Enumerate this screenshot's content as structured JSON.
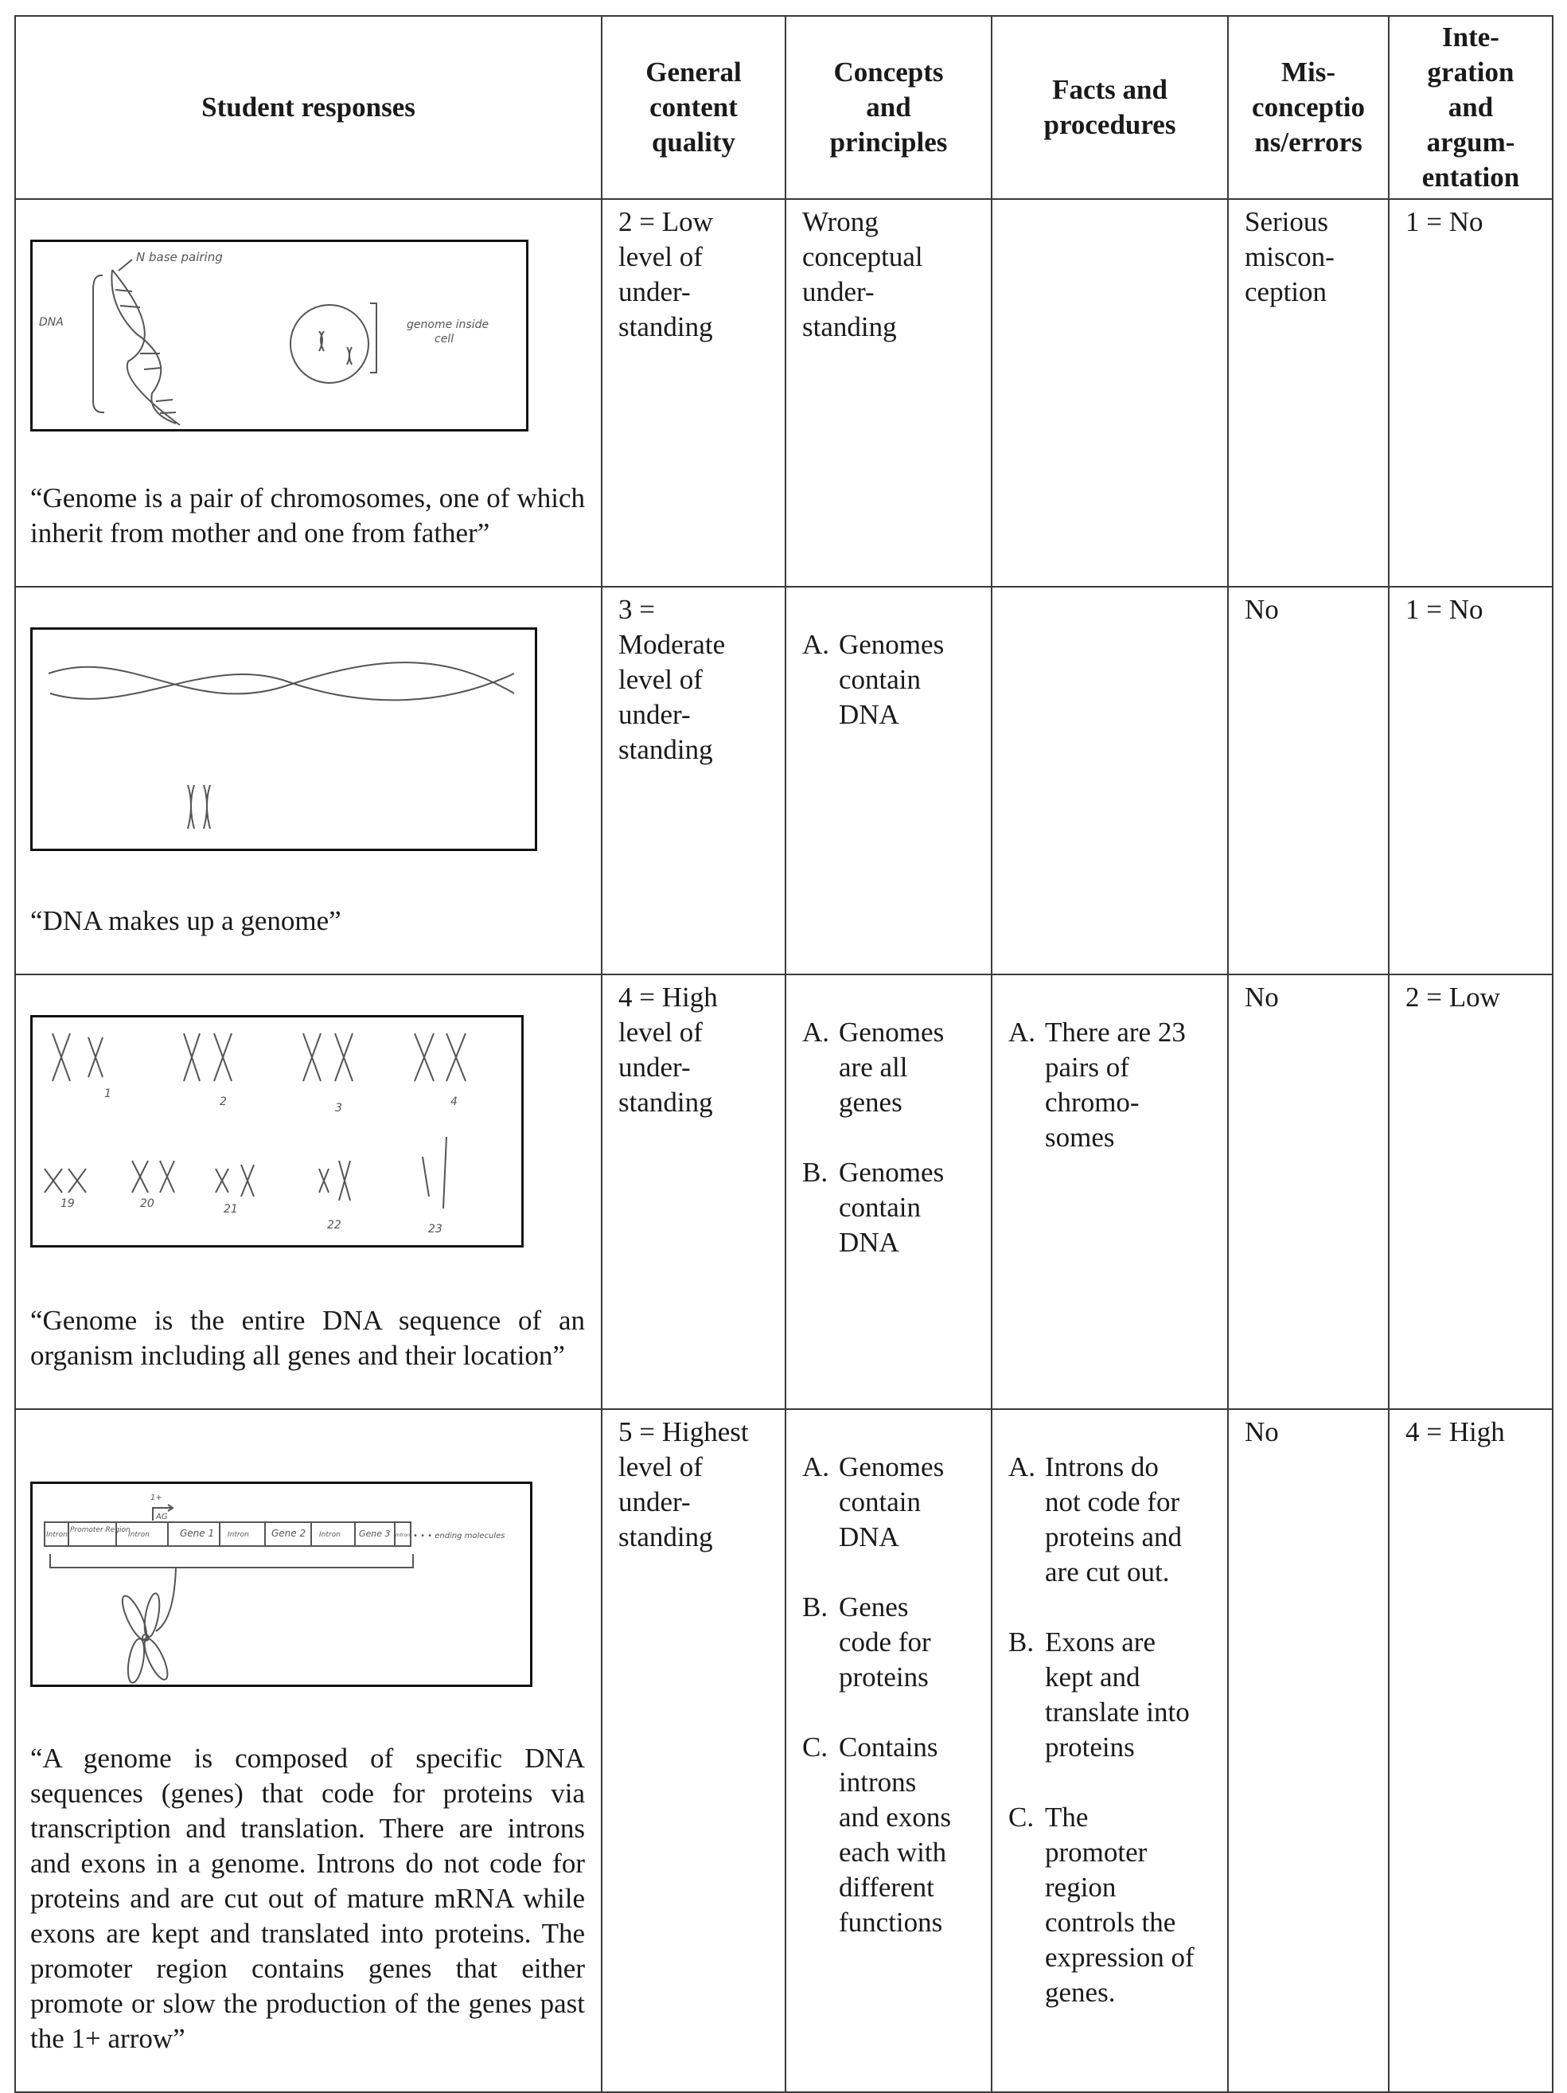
{
  "header": {
    "student_responses": "Student responses",
    "general_content_quality": "General\ncontent\nquality",
    "concepts_principles": "Concepts\nand\nprinciples",
    "facts_procedures": "Facts and\nprocedures",
    "misconceptions": "Mis-\nconceptio\nns/errors",
    "integration": "Inte-\ngration\nand\nargum-\nentation"
  },
  "rows": [
    {
      "sketch_labels": {
        "dna": "DNA",
        "base_pairing": "N base pairing",
        "genome_inside": "genome inside",
        "cell": "cell"
      },
      "quote": "“Genome is a pair of chromosomes, one of which inherit from mother and one from father”",
      "quality": "2 = Low\nlevel of\nunder-\nstanding",
      "concepts_text": "Wrong\nconceptual\nunder-\nstanding",
      "misconceptions": "Serious\nmiscon-\nception",
      "integration": "1 = No"
    },
    {
      "quote": "“DNA makes up a genome”",
      "quality": "3 =\nModerate\nlevel of\nunder-\nstanding",
      "concepts": [
        {
          "marker": "A.",
          "text": "Genomes\ncontain\nDNA"
        }
      ],
      "misconceptions": "No",
      "integration": "1 = No"
    },
    {
      "sketch_labels": [
        "1",
        "2",
        "3",
        "4",
        "19",
        "20",
        "21",
        "22",
        "23"
      ],
      "quote": "“Genome is the entire DNA sequence of an organism including all genes and their location”",
      "quality": "4 = High\nlevel of\nunder-\nstanding",
      "concepts": [
        {
          "marker": "A.",
          "text": "Genomes\nare all\ngenes"
        },
        {
          "marker": "B.",
          "text": "Genomes\ncontain\nDNA"
        }
      ],
      "facts": [
        {
          "marker": "A.",
          "text": "There are 23\npairs of\nchromo-\nsomes"
        }
      ],
      "misconceptions": "No",
      "integration": "2 = Low"
    },
    {
      "sketch_labels": {
        "segments": [
          "Intron",
          "Promoter Region",
          "Intron",
          "Gene 1",
          "Intron",
          "Gene 2",
          "Intron",
          "Gene 3",
          "Intron"
        ],
        "start": "1+",
        "codon": "AG",
        "ending": "• • • ending molecules"
      },
      "quote": "“A genome is composed of specific DNA sequences (genes) that code for proteins via transcription and translation. There are introns and exons in a genome. Introns do not code for proteins and are cut out of mature mRNA while exons are kept and translated into proteins. The promoter region contains genes that either promote or slow the production of the genes past the 1+ arrow”",
      "quality": "5 = Highest\nlevel of\nunder-\nstanding",
      "concepts": [
        {
          "marker": "A.",
          "text": "Genomes\ncontain\nDNA"
        },
        {
          "marker": "B.",
          "text": "Genes\ncode for\nproteins"
        },
        {
          "marker": "C.",
          "text": "Contains\nintrons\nand exons\neach with\ndifferent\nfunctions"
        }
      ],
      "facts": [
        {
          "marker": "A.",
          "text": "Introns do\nnot code for\nproteins and\nare cut out."
        },
        {
          "marker": "B.",
          "text": "Exons are\nkept and\ntranslate into\nproteins"
        },
        {
          "marker": "C.",
          "text": "The\npromoter\nregion\ncontrols the\nexpression of\ngenes."
        }
      ],
      "misconceptions": "No",
      "integration": "4 = High"
    }
  ]
}
